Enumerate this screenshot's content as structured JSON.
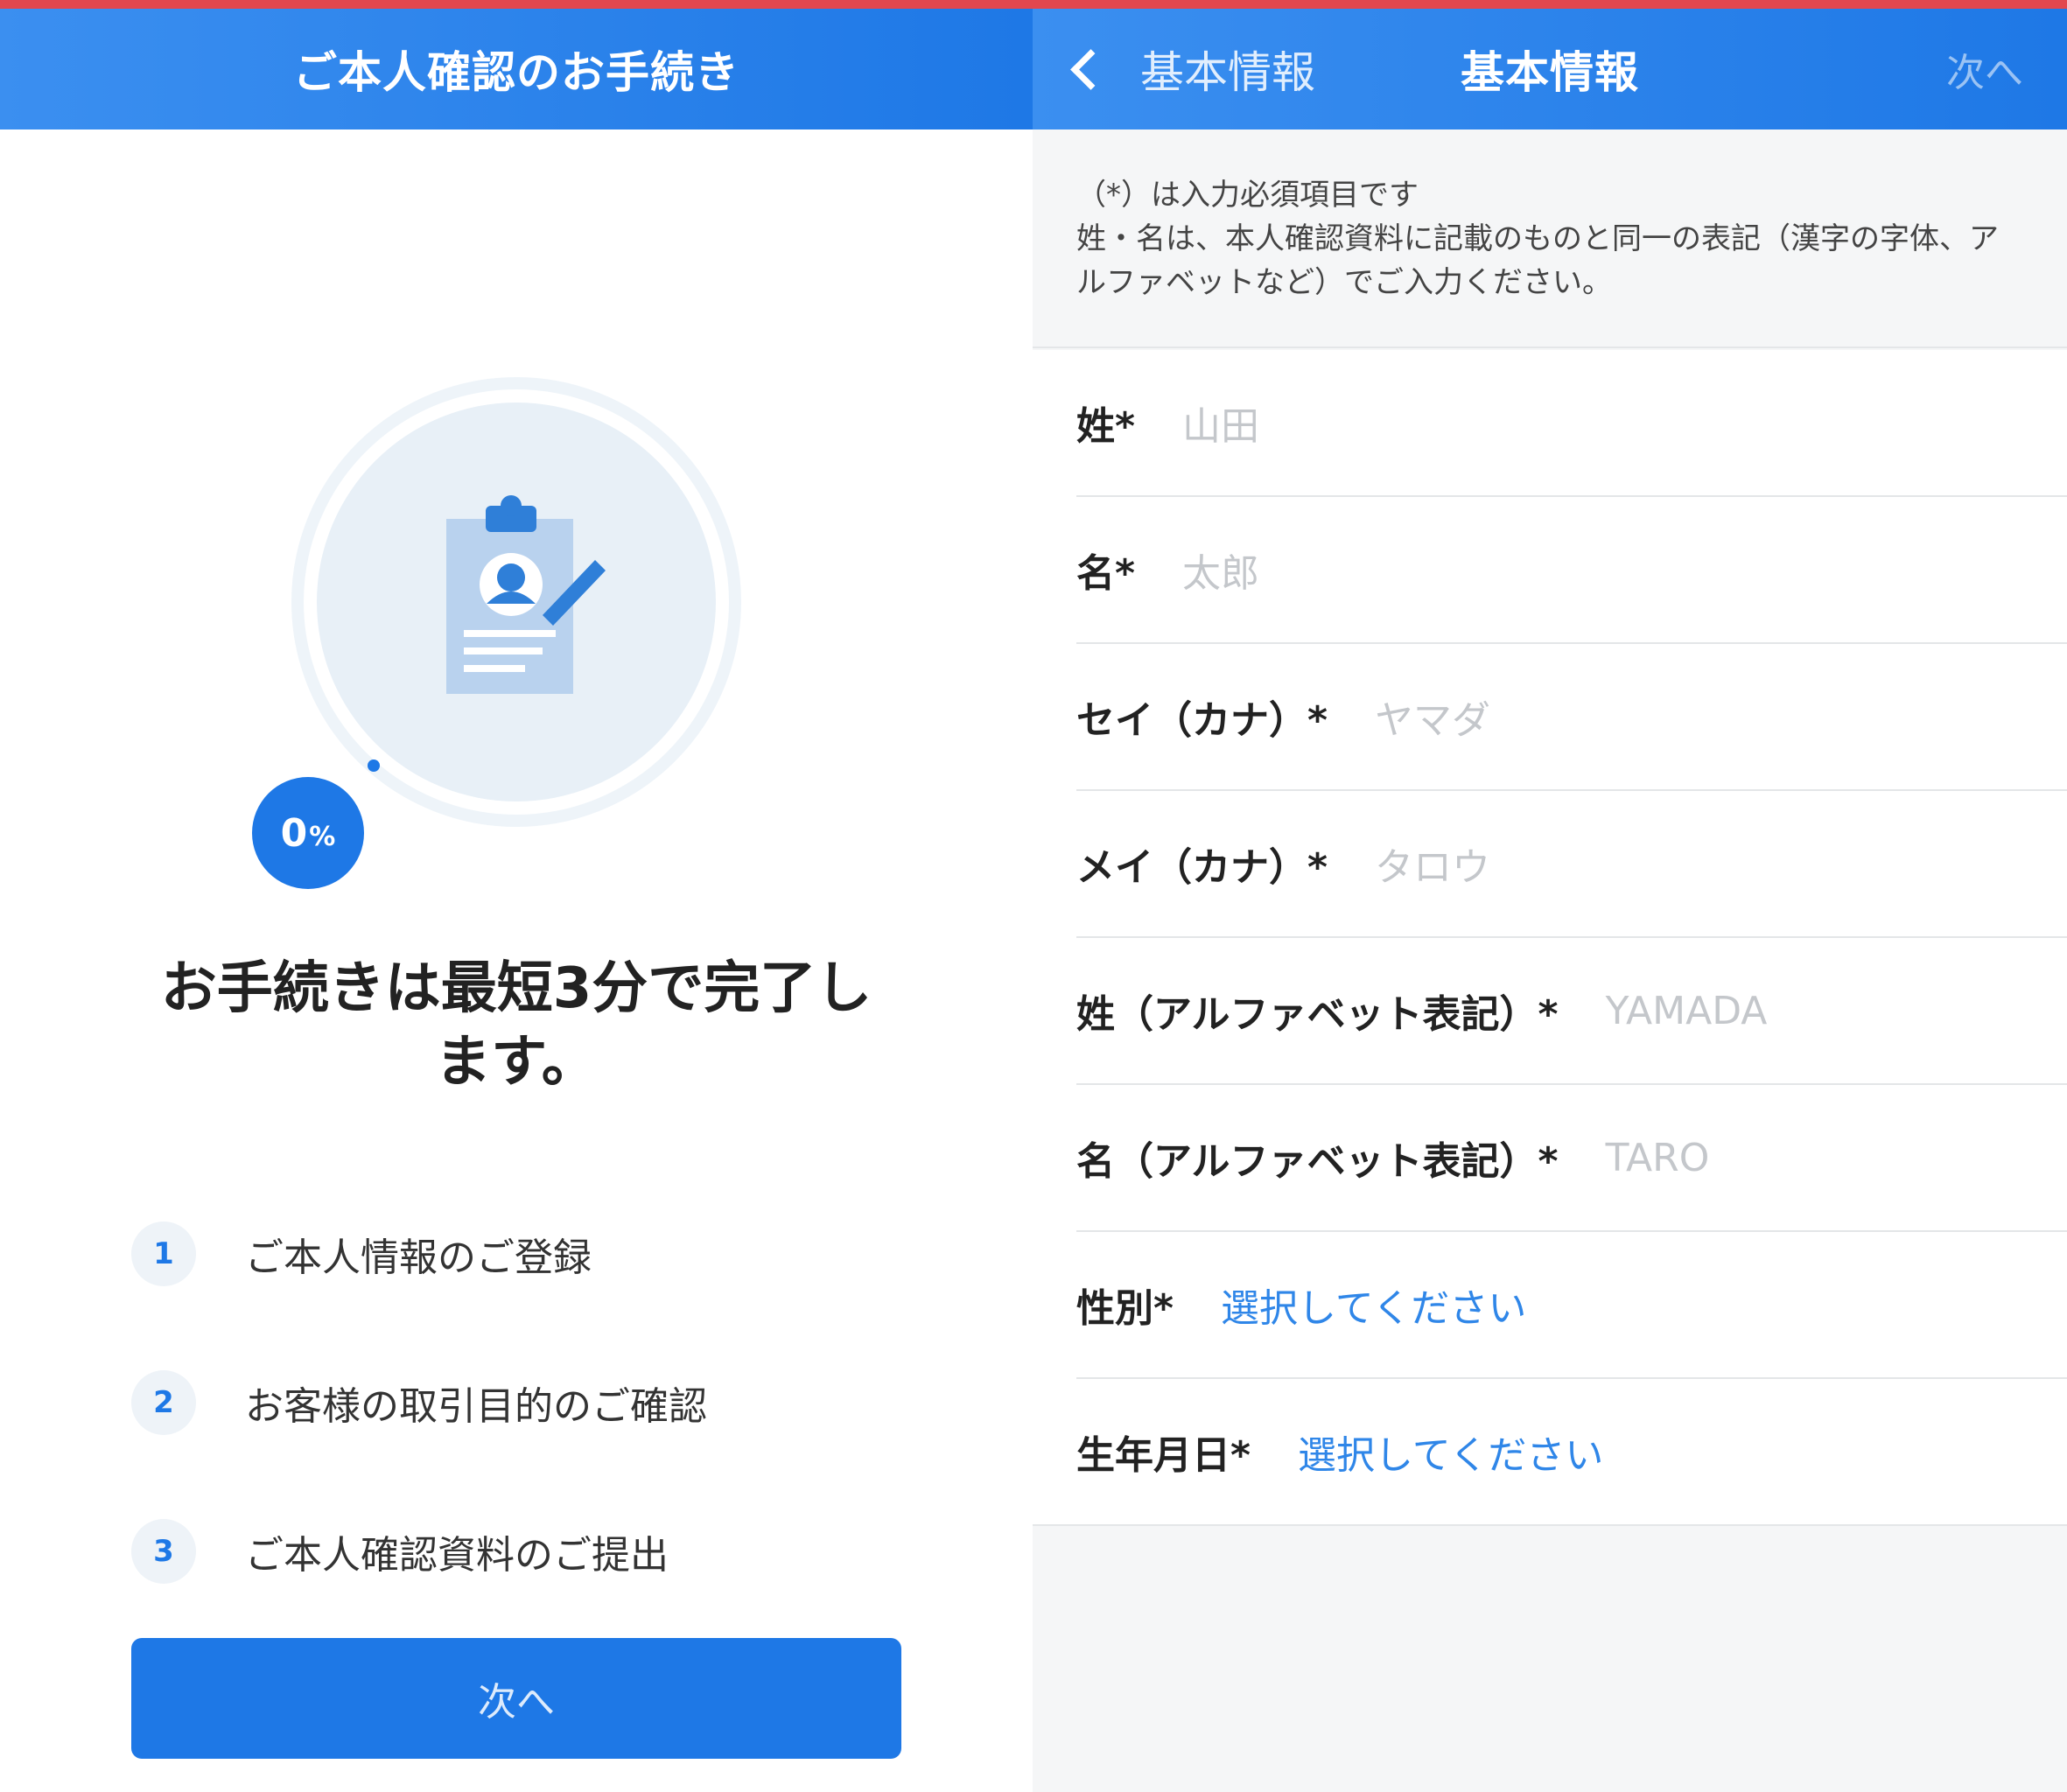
{
  "left": {
    "header_title": "ご本人確認のお手続き",
    "progress_value": "0",
    "progress_unit": "%",
    "headline_line1": "お手続きは最短3分で完了し",
    "headline_line2": "ます。",
    "steps": [
      {
        "num": "1",
        "label": "ご本人情報のご登録"
      },
      {
        "num": "2",
        "label": "お客様の取引目的のご確認"
      },
      {
        "num": "3",
        "label": "ご本人確認資料のご提出"
      }
    ],
    "next_button": "次へ"
  },
  "right": {
    "back_label": "基本情報",
    "header_title": "基本情報",
    "next_label": "次へ",
    "note_line1": "（*）は入力必須項目です",
    "note_line2": "姓・名は、本人確認資料に記載のものと同一の表記（漢字の字体、ア",
    "note_line3": "ルファベットなど）でご入力ください。",
    "fields": [
      {
        "label": "姓*",
        "placeholder": "山田"
      },
      {
        "label": "名*",
        "placeholder": "太郎"
      },
      {
        "label": "セイ（カナ）*",
        "placeholder": "ヤマダ"
      },
      {
        "label": "メイ（カナ）*",
        "placeholder": "タロウ"
      },
      {
        "label": "姓（アルファベット表記）*",
        "placeholder": "YAMADA"
      },
      {
        "label": "名（アルファベット表記）*",
        "placeholder": "TARO"
      },
      {
        "label": "性別*",
        "value": "選択してください"
      },
      {
        "label": "生年月日*",
        "value": "選択してください"
      }
    ]
  },
  "colors": {
    "brand_blue": "#1e78e6",
    "top_accent": "#e2474e",
    "select_link": "#2f86e8"
  },
  "icons": [
    "clipboard-profile-icon",
    "chevron-left-icon"
  ]
}
